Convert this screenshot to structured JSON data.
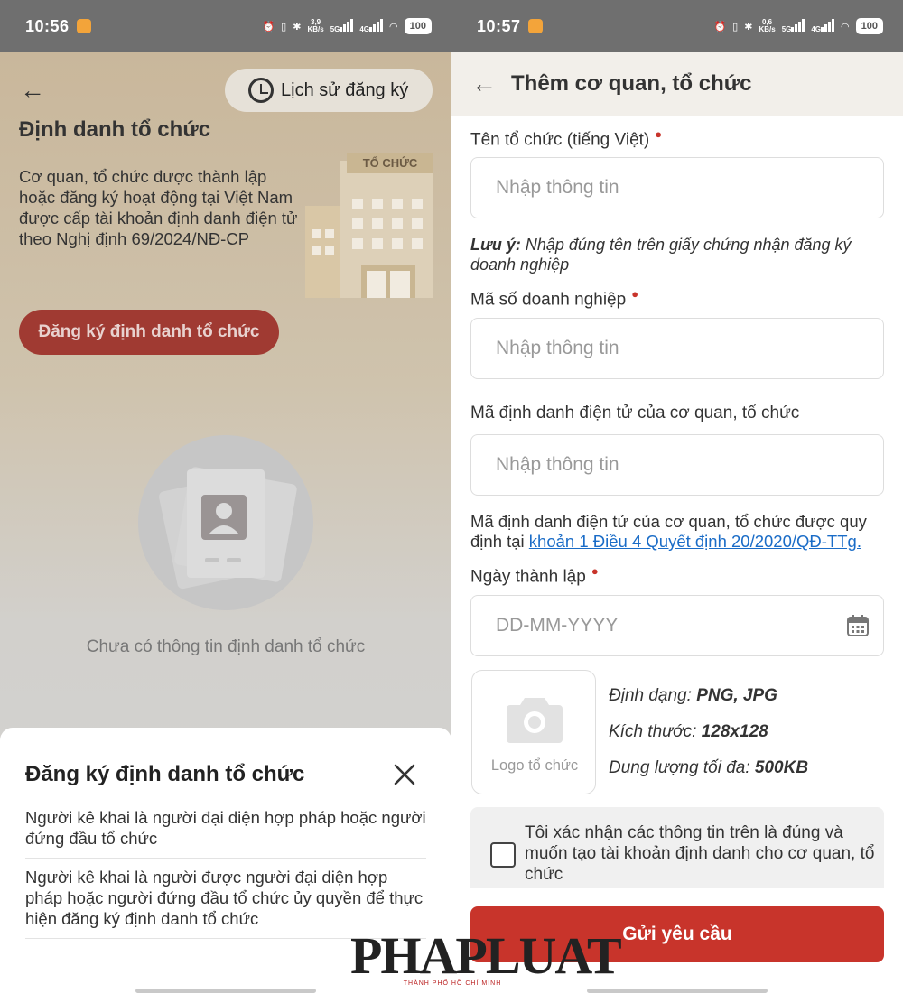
{
  "left": {
    "status": {
      "time": "10:56",
      "speed_top": "3,9",
      "speed_unit": "KB/s",
      "net1": "5G",
      "net2": "4G",
      "battery": "100"
    },
    "history_button": "Lịch sử đăng ký",
    "title": "Định danh tổ chức",
    "description": "Cơ quan, tổ chức được thành lập hoặc đăng ký hoạt động tại Việt Nam được cấp tài khoản định danh điện tử theo Nghị định 69/2024/NĐ-CP",
    "building_sign": "TỔ CHỨC",
    "register_button": "Đăng ký định danh tổ chức",
    "empty_text": "Chưa có thông tin định danh tổ chức",
    "sheet": {
      "title": "Đăng ký định danh tổ chức",
      "options": [
        "Người kê khai là người đại diện hợp pháp hoặc người đứng đầu tổ chức",
        "Người kê khai là người được người đại diện hợp pháp hoặc người đứng đầu tổ chức ủy quyền để thực hiện đăng ký định danh tổ chức"
      ]
    }
  },
  "right": {
    "status": {
      "time": "10:57",
      "speed_top": "0,6",
      "speed_unit": "KB/s",
      "net1": "5G",
      "net2": "4G",
      "battery": "100"
    },
    "header_title": "Thêm cơ quan, tổ chức",
    "fields": {
      "org_name": {
        "label": "Tên tổ chức (tiếng Việt)",
        "placeholder": "Nhập thông tin",
        "required": true
      },
      "org_name_note_label": "Lưu ý:",
      "org_name_note": "Nhập đúng tên trên giấy chứng nhận đăng ký doanh nghiệp",
      "business_code": {
        "label": "Mã số doanh nghiệp",
        "placeholder": "Nhập thông tin",
        "required": true
      },
      "eid_code": {
        "label": "Mã định danh điện tử của cơ quan, tổ chức",
        "placeholder": "Nhập thông tin"
      },
      "eid_info_text": "Mã định danh điện tử của cơ quan, tổ chức được quy định tại",
      "eid_info_link": "khoản 1 Điều 4 Quyết định 20/2020/QĐ-TTg.",
      "founded_date": {
        "label": "Ngày thành lập",
        "placeholder": "DD-MM-YYYY",
        "required": true
      }
    },
    "logo": {
      "label": "Logo tổ chức",
      "format_label": "Định dạng:",
      "format_value": "PNG, JPG",
      "size_label": "Kích thước:",
      "size_value": "128x128",
      "capacity_label": "Dung lượng tối đa:",
      "capacity_value": "500KB"
    },
    "confirm_text": "Tôi xác nhận các thông tin trên là đúng và muốn tạo tài khoản định danh cho cơ quan, tổ chức",
    "submit_button": "Gửi yêu cầu"
  },
  "watermark": {
    "text": "PHAPLUAT",
    "sub": "THÀNH PHỐ HỒ CHÍ MINH"
  },
  "colors": {
    "primary": "#c8342b",
    "link": "#1a6cc7",
    "header_bg": "#f2efea"
  }
}
